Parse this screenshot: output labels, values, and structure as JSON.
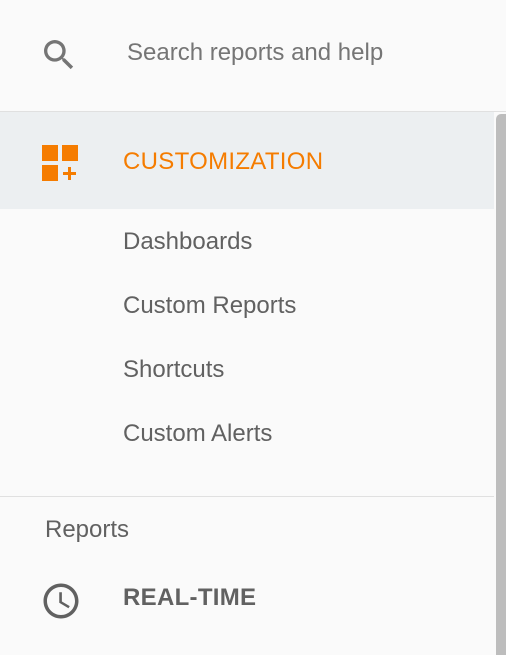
{
  "search": {
    "placeholder": "Search reports and help",
    "icon": "search-icon"
  },
  "customization": {
    "title": "CUSTOMIZATION",
    "icon": "dashboard-add-icon",
    "accent_color": "#f57c00",
    "items": [
      {
        "label": "Dashboards"
      },
      {
        "label": "Custom Reports"
      },
      {
        "label": "Shortcuts"
      },
      {
        "label": "Custom Alerts"
      }
    ]
  },
  "reports": {
    "group_label": "Reports",
    "items": [
      {
        "label": "REAL-TIME",
        "icon": "clock-icon"
      }
    ]
  }
}
